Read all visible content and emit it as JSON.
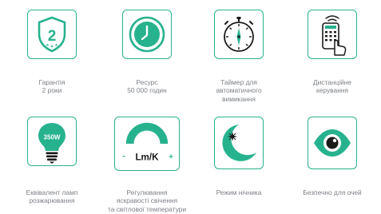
{
  "colors": {
    "accent": "#27b28e",
    "caption_text": "#7d8086",
    "background": "#ffffff"
  },
  "features": [
    {
      "icon": "shield-warranty-icon",
      "icon_text": "2",
      "caption": "Гарантія\n2 роки"
    },
    {
      "icon": "clock-icon",
      "caption": "Ресурс\n50 000 годин"
    },
    {
      "icon": "stopwatch-icon",
      "caption": "Таймер для\nавтоматичного\nвимикання"
    },
    {
      "icon": "remote-control-icon",
      "caption": "Дистанційне\nкерування"
    },
    {
      "icon": "light-bulb-icon",
      "icon_text": "350W",
      "caption": "Еквівалент ламп\nрозжарювання"
    },
    {
      "icon": "brightness-adjust-icon",
      "icon_text": "Lm/K",
      "minus_sign": "-",
      "plus_sign": "+",
      "caption": "Регулювання\nяскравості свічення\nта світлової температури"
    },
    {
      "icon": "moon-star-icon",
      "caption": "Режим нічника"
    },
    {
      "icon": "eye-icon",
      "caption": "Безпечно для очей"
    }
  ]
}
